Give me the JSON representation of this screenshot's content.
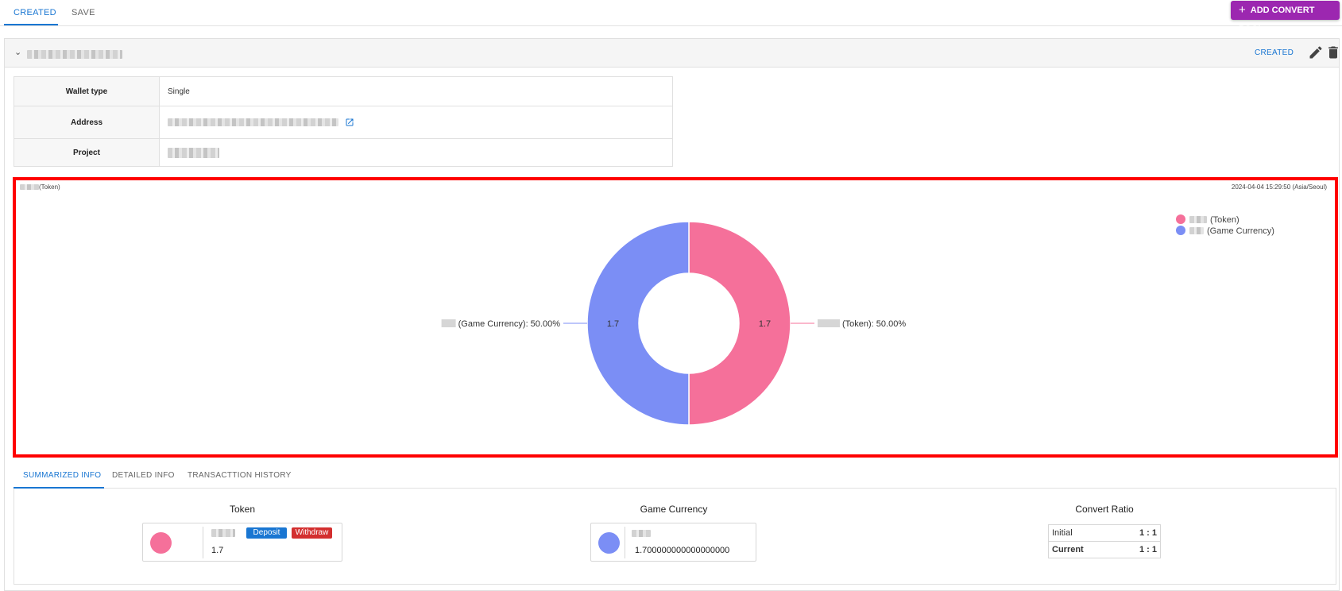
{
  "top_tabs": [
    {
      "label": "CREATED",
      "active": true
    },
    {
      "label": "SAVE",
      "active": false
    }
  ],
  "add_button": {
    "icon": "plus-icon",
    "label": "ADD CONVERT POOL"
  },
  "pool": {
    "status": "CREATED",
    "info": [
      {
        "label": "Wallet type",
        "value": "Single"
      },
      {
        "label": "Address",
        "value": ""
      },
      {
        "label": "Project",
        "value": ""
      }
    ]
  },
  "chart_header": {
    "title_suffix": "(Token)",
    "timestamp": "2024-04-04 15:29:50 (Asia/Seoul)"
  },
  "chart_data": {
    "type": "pie",
    "donut": true,
    "series": [
      {
        "name": "(Token)",
        "value": 1.7,
        "percent": "50.00%",
        "color": "#f5709a",
        "label": "(Token): 50.00%"
      },
      {
        "name": "(Game Currency)",
        "value": 1.7,
        "percent": "50.00%",
        "color": "#7b8ef5",
        "label": "(Game Currency): 50.00%"
      }
    ],
    "legend_position": "top-right",
    "data_labels": [
      "1.7",
      "1.7"
    ]
  },
  "bottom_tabs": [
    {
      "label": "SUMMARIZED INFO",
      "active": true
    },
    {
      "label": "DETAILED INFO",
      "active": false
    },
    {
      "label": "TRANSACTTION HISTORY",
      "active": false
    }
  ],
  "summary": {
    "token": {
      "title": "Token",
      "color": "#f5709a",
      "deposit_label": "Deposit",
      "withdraw_label": "Withdraw",
      "amount": "1.7"
    },
    "game_currency": {
      "title": "Game Currency",
      "color": "#7b8ef5",
      "amount": "1.700000000000000000"
    },
    "convert_ratio": {
      "title": "Convert Ratio",
      "rows": [
        {
          "label": "Initial",
          "value": "1 : 1"
        },
        {
          "label": "Current",
          "value": "1 : 1"
        }
      ]
    }
  },
  "colors": {
    "accent": "#1976d2",
    "add_button": "#9c27b0",
    "deposit": "#1976d2",
    "withdraw": "#d32f2f",
    "highlight_border": "#ff0000"
  }
}
